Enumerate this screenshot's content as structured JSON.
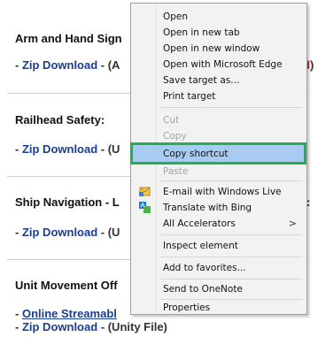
{
  "page": {
    "sections": [
      {
        "title": "Arm and Hand Sign",
        "lines": [
          {
            "prefix": "- ",
            "link": "Zip Download",
            "suffix": " - (A",
            "trailing": "d",
            "trailing_tail": ")"
          }
        ]
      },
      {
        "title": "Railhead Safety:",
        "lines": [
          {
            "prefix": "- ",
            "link": "Zip Download",
            "suffix": " - (U"
          }
        ]
      },
      {
        "title": "Ship Navigation - L",
        "title_tail": ":",
        "lines": [
          {
            "prefix": "- ",
            "link": "Zip Download",
            "suffix": " - (U"
          }
        ]
      },
      {
        "title": "Unit Movement Off",
        "lines": [
          {
            "prefix": "- ",
            "link": "Online Streamabl",
            "suffix": ""
          },
          {
            "prefix": "- ",
            "link": "Zip Download",
            "suffix": " - (Unity File)"
          }
        ]
      }
    ]
  },
  "context_menu": {
    "items": [
      {
        "label": "Open",
        "enabled": true
      },
      {
        "label": "Open in new tab",
        "enabled": true
      },
      {
        "label": "Open in new window",
        "enabled": true
      },
      {
        "label": "Open with Microsoft Edge",
        "enabled": true
      },
      {
        "label": "Save target as...",
        "enabled": true
      },
      {
        "label": "Print target",
        "enabled": true
      },
      {
        "label": "Cut",
        "enabled": false
      },
      {
        "label": "Copy",
        "enabled": false
      },
      {
        "label": "Copy shortcut",
        "enabled": true,
        "highlighted": true
      },
      {
        "label": "Paste",
        "enabled": false
      },
      {
        "label": "E-mail with Windows Live",
        "enabled": true,
        "icon": "windows-live-mail-icon"
      },
      {
        "label": "Translate with Bing",
        "enabled": true,
        "icon": "bing-translate-icon"
      },
      {
        "label": "All Accelerators",
        "enabled": true,
        "submenu_arrow": ">"
      },
      {
        "label": "Inspect element",
        "enabled": true
      },
      {
        "label": "Add to favorites...",
        "enabled": true
      },
      {
        "label": "Send to OneNote",
        "enabled": true
      },
      {
        "label": "Properties",
        "enabled": true
      }
    ]
  },
  "colors": {
    "highlight_fill": "#a9cbf2",
    "highlight_border": "#22b14c",
    "link": "#1a3d8f"
  }
}
